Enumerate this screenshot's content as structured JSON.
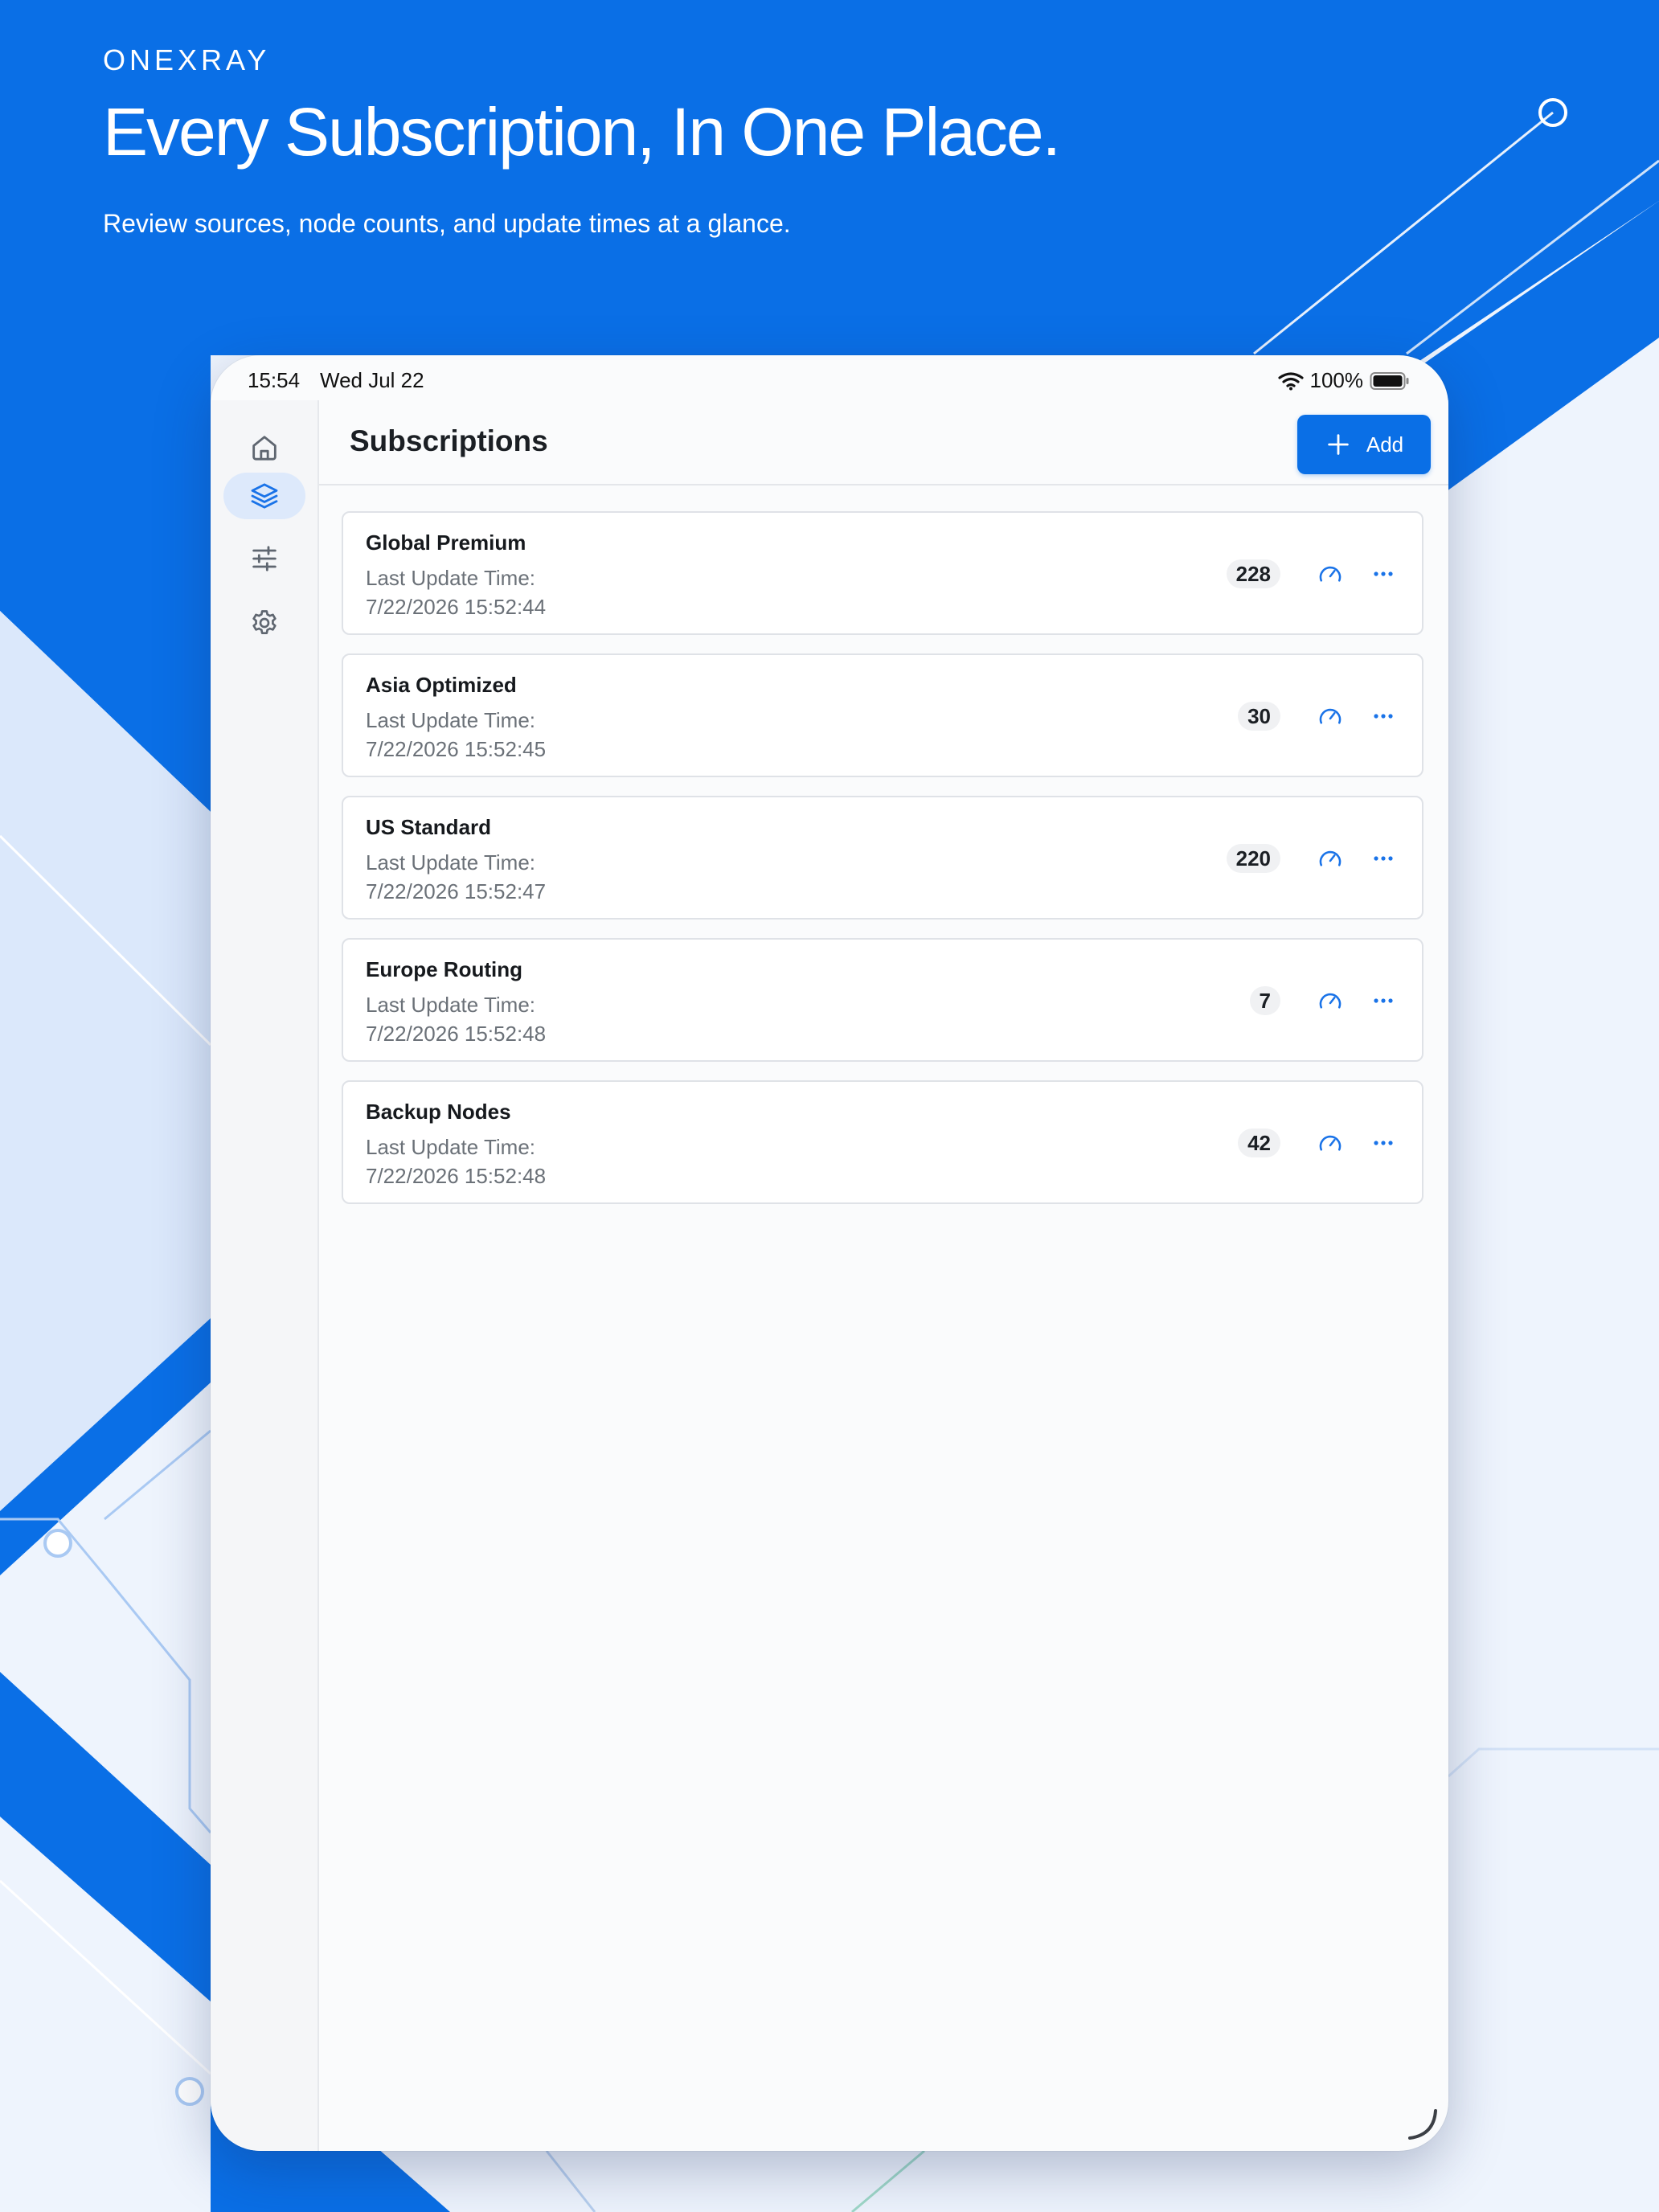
{
  "hero": {
    "brand": "ONEXRAY",
    "headline": "Every Subscription, In One Place.",
    "subline": "Review sources, node counts, and update times at a glance."
  },
  "status_bar": {
    "time": "15:54",
    "date": "Wed Jul 22",
    "battery": "100%"
  },
  "sidebar": {
    "items": [
      {
        "icon": "home-icon",
        "active": false
      },
      {
        "icon": "layers-icon",
        "active": true
      },
      {
        "icon": "sliders-icon",
        "active": false
      },
      {
        "icon": "gear-icon",
        "active": false
      }
    ]
  },
  "header": {
    "title": "Subscriptions",
    "add_label": "Add"
  },
  "subscriptions": [
    {
      "name": "Global Premium",
      "label": "Last Update Time:",
      "time": "7/22/2026 15:52:44",
      "count": "228"
    },
    {
      "name": "Asia Optimized",
      "label": "Last Update Time:",
      "time": "7/22/2026 15:52:45",
      "count": "30"
    },
    {
      "name": "US Standard",
      "label": "Last Update Time:",
      "time": "7/22/2026 15:52:47",
      "count": "220"
    },
    {
      "name": "Europe Routing",
      "label": "Last Update Time:",
      "time": "7/22/2026 15:52:48",
      "count": "7"
    },
    {
      "name": "Backup Nodes",
      "label": "Last Update Time:",
      "time": "7/22/2026 15:52:48",
      "count": "42"
    }
  ],
  "colors": {
    "brand_blue": "#0a6fe6",
    "accent_blue": "#1a73e8",
    "active_nav_bg": "#dde9fb"
  }
}
